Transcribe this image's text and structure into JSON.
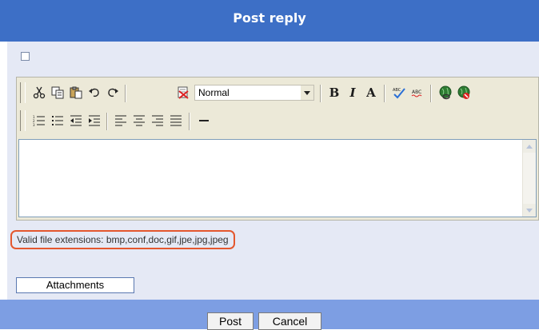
{
  "header": {
    "title": "Post reply"
  },
  "editor": {
    "toolbar1": {
      "cut": "scissors-icon",
      "copy": "copy-icon",
      "paste": "paste-icon",
      "undo": "undo-icon",
      "redo": "redo-icon",
      "remove_format": "remove-format-icon",
      "format_value": "Normal",
      "bold": "B",
      "italic": "I",
      "font": "A",
      "spellcheck": "spellcheck-icon",
      "abc": "abc-icon",
      "link": "link-icon",
      "unlink": "unlink-icon"
    },
    "toolbar2": {
      "numbered_list": "numbered-list-icon",
      "bullet_list": "bullet-list-icon",
      "outdent": "outdent-icon",
      "indent": "indent-icon",
      "align_left": "align-left-icon",
      "align_center": "align-center-icon",
      "align_right": "align-right-icon",
      "justify": "justify-icon",
      "horizontal_rule": "horizontal-rule-icon"
    },
    "body_text": ""
  },
  "attachments": {
    "valid_extensions_text": "Valid file extensions: bmp,conf,doc,gif,jpe,jpg,jpeg",
    "button_label": "Attachments"
  },
  "footer": {
    "post_label": "Post",
    "cancel_label": "Cancel"
  },
  "colors": {
    "header_bg": "#3d6fc6",
    "footer_bg": "#7d9ee3",
    "panel_bg": "#e5e9f5",
    "highlight_border": "#e4572e"
  }
}
